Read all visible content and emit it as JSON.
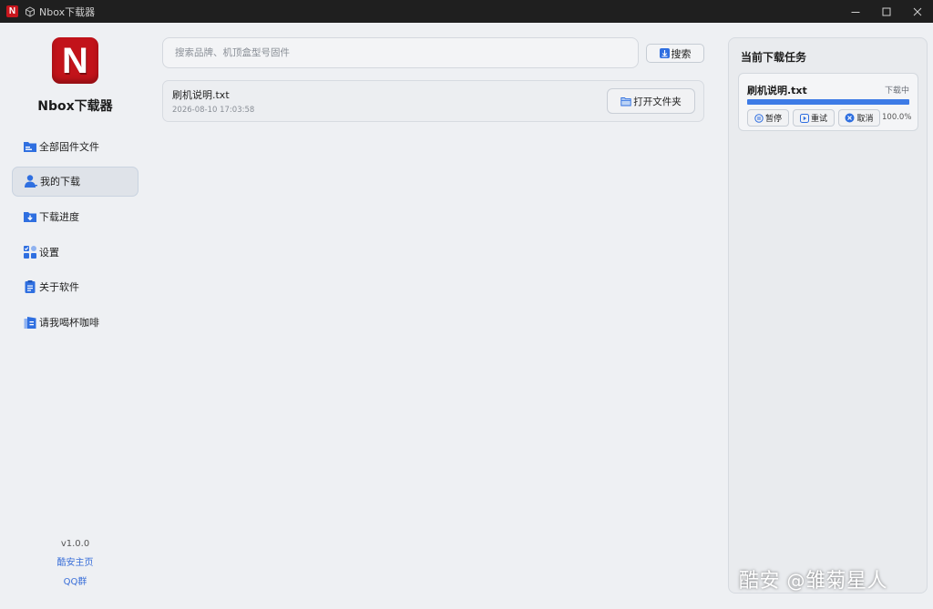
{
  "titlebar": {
    "app_icon_letter": "N",
    "title": "Nbox下载器",
    "controls": {
      "minimize": "minimize-icon",
      "maximize": "maximize-icon",
      "close": "close-icon"
    }
  },
  "sidebar": {
    "logo_letter": "N",
    "app_name": "Nbox下载器",
    "items": [
      {
        "label": "全部固件文件",
        "icon": "folder-icon",
        "active": false
      },
      {
        "label": "我的下载",
        "icon": "user-icon",
        "active": true
      },
      {
        "label": "下载进度",
        "icon": "download-icon",
        "active": false
      },
      {
        "label": "设置",
        "icon": "settings-icon",
        "active": false
      },
      {
        "label": "关于软件",
        "icon": "clipboard-icon",
        "active": false
      },
      {
        "label": "请我喝杯咖啡",
        "icon": "coffee-icon",
        "active": false
      }
    ],
    "version": "v1.0.0",
    "links": [
      "酷安主页",
      "QQ群"
    ]
  },
  "main": {
    "search": {
      "placeholder": "搜索品牌、机顶盒型号固件",
      "value": ""
    },
    "search_button": "搜索",
    "files": [
      {
        "name": "刷机说明.txt",
        "time": "2026-08-10 17:03:58",
        "action": "打开文件夹"
      }
    ]
  },
  "task_panel": {
    "title": "当前下载任务",
    "tasks": [
      {
        "name": "刷机说明.txt",
        "status": "下载中",
        "progress": 100.0,
        "progress_label": "100.0%",
        "buttons": {
          "pause": "暂停",
          "retry": "重试",
          "cancel": "取消"
        }
      }
    ]
  },
  "watermark": {
    "brand": "酷安",
    "at": "@",
    "user": "雏菊星人"
  },
  "colors": {
    "accent": "#3d7be6",
    "brand_red": "#c2131a",
    "link": "#3a6fd8"
  }
}
